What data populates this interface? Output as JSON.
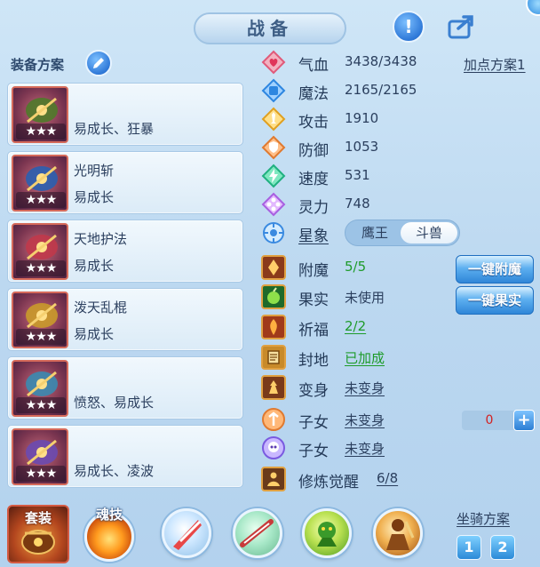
{
  "header": {
    "title": "战备"
  },
  "equipment": {
    "scheme_label": "装备方案",
    "items": [
      {
        "name": "",
        "traits": "易成长、狂暴",
        "stars": "★★★",
        "tint": "#4f7a2a"
      },
      {
        "name": "光明斩",
        "traits": "易成长",
        "stars": "★★★",
        "tint": "#2a5fb0"
      },
      {
        "name": "天地护法",
        "traits": "易成长",
        "stars": "★★★",
        "tint": "#c0394a"
      },
      {
        "name": "泼天乱棍",
        "traits": "易成长",
        "stars": "★★★",
        "tint": "#c99a2a"
      },
      {
        "name": "",
        "traits": "愤怒、易成长",
        "stars": "★★★",
        "tint": "#3a8ab0"
      },
      {
        "name": "",
        "traits": "易成长、凌波",
        "stars": "★★★",
        "tint": "#6a4ab0"
      }
    ]
  },
  "stats": {
    "point_scheme": "加点方案1",
    "hp": {
      "label": "气血",
      "value": "3438/3438"
    },
    "mp": {
      "label": "魔法",
      "value": "2165/2165"
    },
    "attack": {
      "label": "攻击",
      "value": "1910"
    },
    "defense": {
      "label": "防御",
      "value": "1053"
    },
    "speed": {
      "label": "速度",
      "value": "531"
    },
    "spirit": {
      "label": "灵力",
      "value": "748"
    },
    "star": {
      "label": "星象",
      "options": [
        "鹰王",
        "斗兽"
      ],
      "selected": "斗兽"
    }
  },
  "extras": {
    "enchant": {
      "label": "附魔",
      "value": "5/5",
      "button": "一键附魔"
    },
    "fruit": {
      "label": "果实",
      "value": "未使用",
      "button": "一键果实"
    },
    "blessing": {
      "label": "祈福",
      "value": "2/2"
    },
    "seal": {
      "label": "封地",
      "value": "已加成"
    },
    "transform": {
      "label": "变身",
      "value": "未变身"
    },
    "child1": {
      "label": "子女",
      "value": "未变身",
      "count": "0"
    },
    "child2": {
      "label": "子女",
      "value": "未变身"
    },
    "cultivation": {
      "label": "修炼觉醒",
      "value": "6/8"
    }
  },
  "bottom": {
    "set_label": "套装",
    "soul_label": "魂技",
    "mount_label": "坐骑方案",
    "mount_options": [
      "1",
      "2"
    ]
  }
}
